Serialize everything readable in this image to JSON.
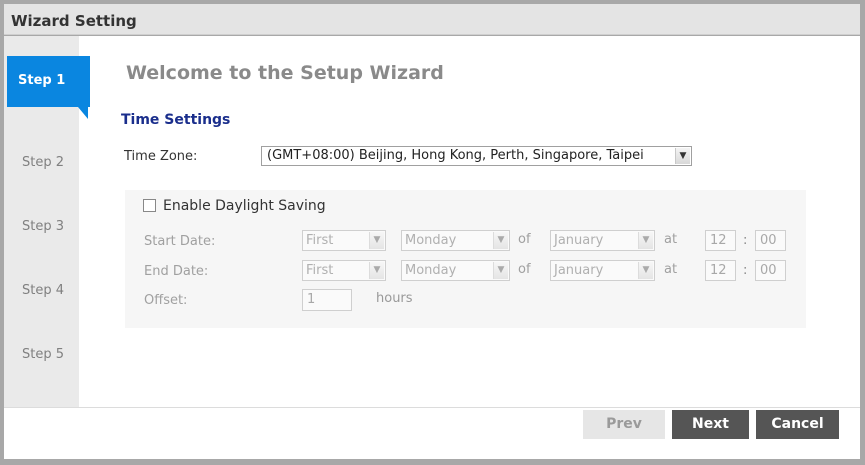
{
  "window": {
    "title": "Wizard Setting"
  },
  "steps": [
    {
      "label": "Step 1",
      "active": true
    },
    {
      "label": "Step 2",
      "active": false
    },
    {
      "label": "Step 3",
      "active": false
    },
    {
      "label": "Step 4",
      "active": false
    },
    {
      "label": "Step 5",
      "active": false
    }
  ],
  "main": {
    "heading": "Welcome to the Setup Wizard",
    "section_title": "Time Settings",
    "time_zone": {
      "label": "Time Zone:",
      "value": "(GMT+08:00) Beijing, Hong Kong, Perth, Singapore, Taipei"
    },
    "daylight": {
      "checkbox_label": "Enable Daylight Saving",
      "checked": false,
      "start": {
        "label": "Start Date:",
        "week": "First",
        "day": "Monday",
        "of": "of",
        "month": "January",
        "at": "at",
        "hour": "12",
        "sep": ":",
        "minute": "00"
      },
      "end": {
        "label": "End Date:",
        "week": "First",
        "day": "Monday",
        "of": "of",
        "month": "January",
        "at": "at",
        "hour": "12",
        "sep": ":",
        "minute": "00"
      },
      "offset": {
        "label": "Offset:",
        "value": "1",
        "unit": "hours"
      }
    }
  },
  "footer": {
    "prev": "Prev",
    "next": "Next",
    "cancel": "Cancel"
  },
  "colors": {
    "accent": "#0a86e0",
    "section_title": "#1a2e8c",
    "button_dark": "#555555"
  },
  "icons": {
    "dropdown": "chevron-down-icon",
    "checkbox": "checkbox-icon"
  }
}
